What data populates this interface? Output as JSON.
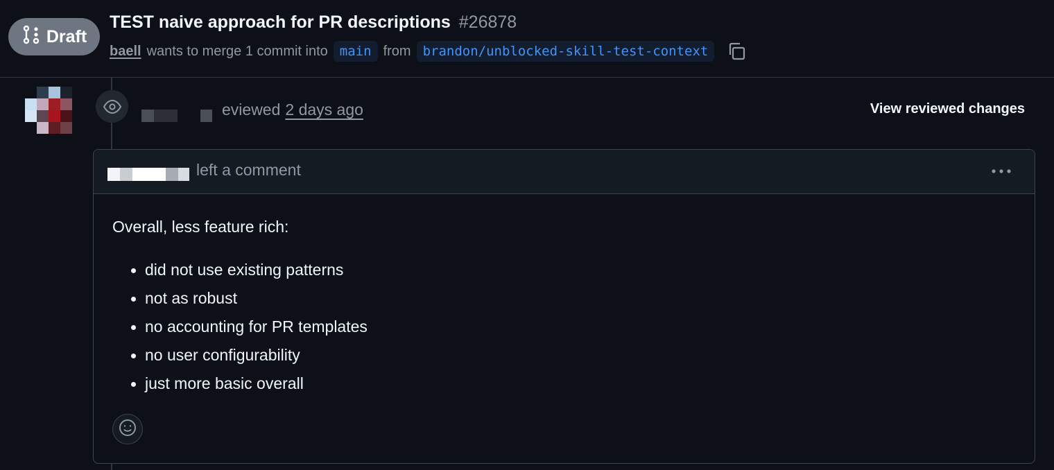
{
  "header": {
    "state_label": "Draft",
    "title": "TEST naive approach for PR descriptions",
    "number": "#26878",
    "author": "baell",
    "merge_text": "wants to merge 1 commit into",
    "base_branch": "main",
    "from_text": "from",
    "head_branch": "brandon/unblocked-skill-test-context"
  },
  "timeline": {
    "event_text": "eviewed",
    "event_time": "2 days ago",
    "view_changes_label": "View reviewed changes"
  },
  "comment": {
    "action": "left a comment",
    "intro": "Overall, less feature rich:",
    "items": [
      "did not use existing patterns",
      "not as robust",
      "no accounting for PR templates",
      "no user configurability",
      "just more basic overall"
    ]
  },
  "icons": {
    "state": "git-pull-request-draft-icon",
    "copy": "copy-icon",
    "event": "eye-icon",
    "menu": "kebab-horizontal-icon",
    "reaction": "smiley-icon"
  },
  "colors": {
    "background": "#0d1117",
    "draft_badge": "#6e7681",
    "branch_text": "#4493f8",
    "branch_bg": "#121d2f",
    "border": "#3d444d"
  }
}
